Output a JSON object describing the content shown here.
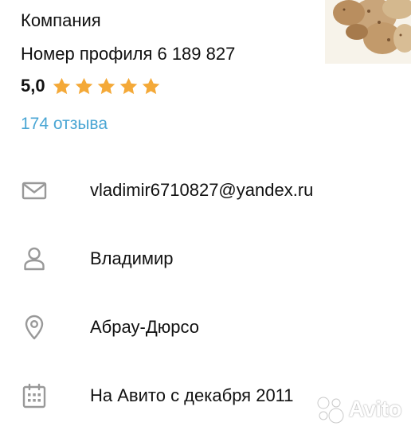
{
  "profile": {
    "company_label": "Компания",
    "profile_number": "Номер профиля 6 189 827",
    "rating": "5,0",
    "stars": 5,
    "reviews": "174 отзыва"
  },
  "info": {
    "email": "vladimir6710827@yandex.ru",
    "name": "Владимир",
    "city": "Абрау-Дюрсо",
    "since": "На Авито с декабря 2011"
  },
  "watermark": {
    "text": "Avito"
  },
  "colors": {
    "star": "#f4a938",
    "link": "#4aa6d4",
    "icon": "#999999"
  },
  "icons": [
    "mail-icon",
    "user-icon",
    "location-pin-icon",
    "calendar-icon",
    "star-icon"
  ]
}
